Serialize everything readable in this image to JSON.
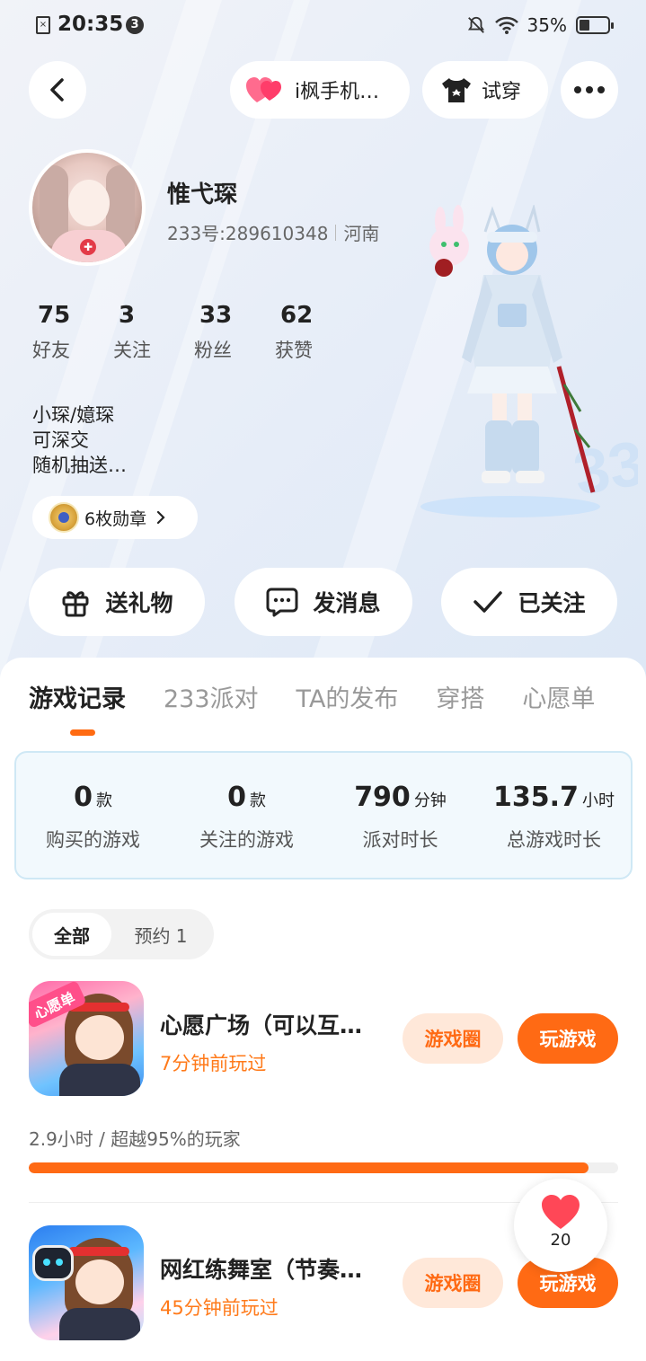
{
  "status_bar": {
    "time": "20:35",
    "notification_count": "3",
    "battery": "35%"
  },
  "top_nav": {
    "game_pill": "i枫手机…",
    "try_on": "试穿"
  },
  "profile": {
    "name": "惟弋琛",
    "uid": "233号:289610348",
    "location": "河南",
    "stats": [
      {
        "value": "75",
        "label": "好友"
      },
      {
        "value": "3",
        "label": "关注"
      },
      {
        "value": "33",
        "label": "粉丝"
      },
      {
        "value": "62",
        "label": "获赞"
      }
    ],
    "bio": [
      "小琛/嬑琛",
      "可深交",
      "随机抽送…"
    ],
    "medals": "6枚勋章"
  },
  "actions": {
    "gift": "送礼物",
    "message": "发消息",
    "followed": "已关注"
  },
  "tabs": [
    "游戏记录",
    "233派对",
    "TA的发布",
    "穿搭",
    "心愿单"
  ],
  "summary": [
    {
      "value": "0",
      "unit": "款",
      "label": "购买的游戏"
    },
    {
      "value": "0",
      "unit": "款",
      "label": "关注的游戏"
    },
    {
      "value": "790",
      "unit": "分钟",
      "label": "派对时长"
    },
    {
      "value": "135.7",
      "unit": "小时",
      "label": "总游戏时长"
    }
  ],
  "filters": {
    "all": "全部",
    "reserved": "预约 1"
  },
  "games": [
    {
      "title": "心愿广场（可以互…",
      "last_played": "7分钟前玩过",
      "tag": "心愿单",
      "circle_btn": "游戏圈",
      "play_btn": "玩游戏"
    },
    {
      "title": "网红练舞室（节奏…",
      "last_played": "45分钟前玩过",
      "circle_btn": "游戏圈",
      "play_btn": "玩游戏"
    }
  ],
  "first_game_playtime": "2.9小时 / 超越95%的玩家",
  "first_game_progress": 0.95,
  "float_like_count": "20",
  "colors": {
    "accent": "#ff6a14",
    "accent_light": "#ffe8d9",
    "summary_bg": "#f2f9fd"
  }
}
